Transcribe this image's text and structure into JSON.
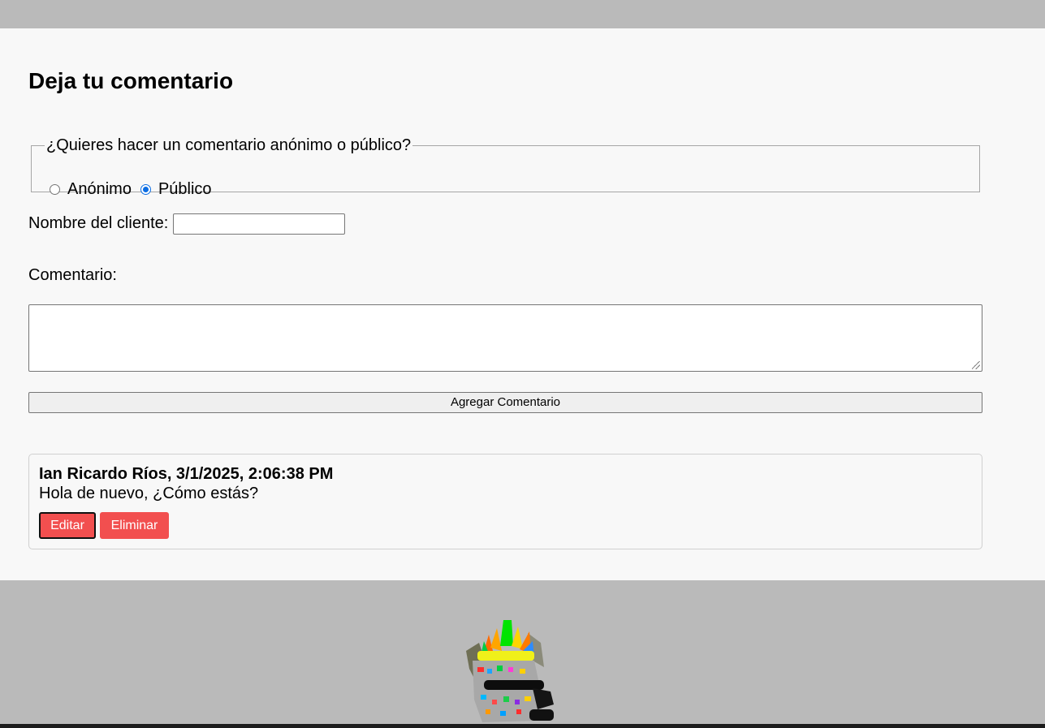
{
  "form": {
    "title": "Deja tu comentario",
    "mode_legend": "¿Quieres hacer un comentario anónimo o público?",
    "mode_options": [
      {
        "label": "Anónimo",
        "selected": false
      },
      {
        "label": "Público",
        "selected": true
      }
    ],
    "name_label": "Nombre del cliente:",
    "name_value": "",
    "comment_label": "Comentario:",
    "comment_value": "",
    "submit_label": "Agregar Comentario"
  },
  "comments": [
    {
      "author_date": "Ian Ricardo Ríos, 3/1/2025, 2:06:38 PM",
      "text": "Hola de nuevo, ¿Cómo estás?",
      "edit_label": "Editar",
      "delete_label": "Eliminar"
    }
  ],
  "colors": {
    "accent_radio": "#0b6de3",
    "button_red": "#f24f4f",
    "background_panel": "#f8f8f8",
    "background_outer": "#bababa"
  },
  "footer": {
    "mascot_icon": "colorful-mascot-image"
  }
}
